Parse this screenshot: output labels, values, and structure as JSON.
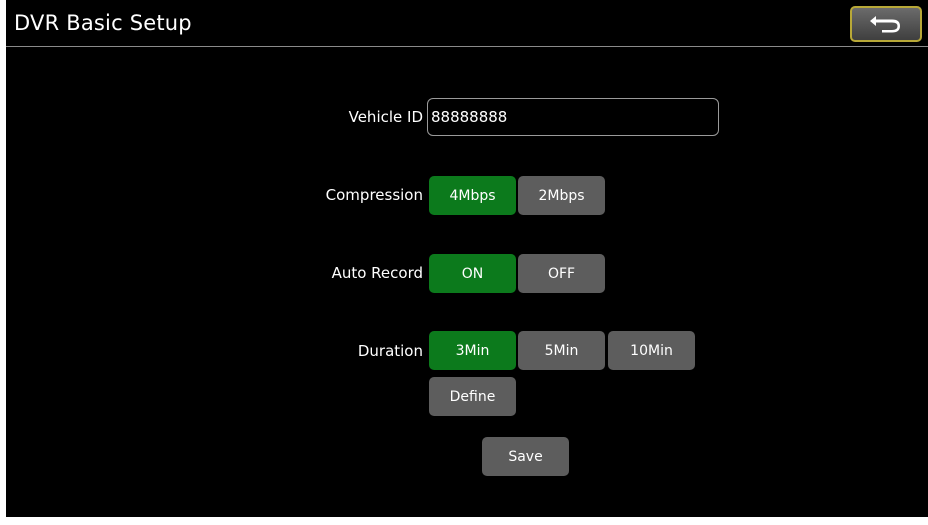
{
  "header": {
    "title": "DVR Basic Setup",
    "back_icon": "back-arrow-icon"
  },
  "form": {
    "vehicle_id": {
      "label": "Vehicle ID",
      "value": "88888888"
    },
    "compression": {
      "label": "Compression",
      "options": [
        "4Mbps",
        "2Mbps"
      ],
      "selected": "4Mbps"
    },
    "auto_record": {
      "label": "Auto Record",
      "options": [
        "ON",
        "OFF"
      ],
      "selected": "ON"
    },
    "duration": {
      "label": "Duration",
      "options": [
        "3Min",
        "5Min",
        "10Min",
        "Define"
      ],
      "selected": "3Min"
    },
    "save_label": "Save"
  },
  "colors": {
    "background": "#000000",
    "selected": "#0c7a1c",
    "unselected": "#5d5d5d",
    "back_border": "#b8a837"
  }
}
